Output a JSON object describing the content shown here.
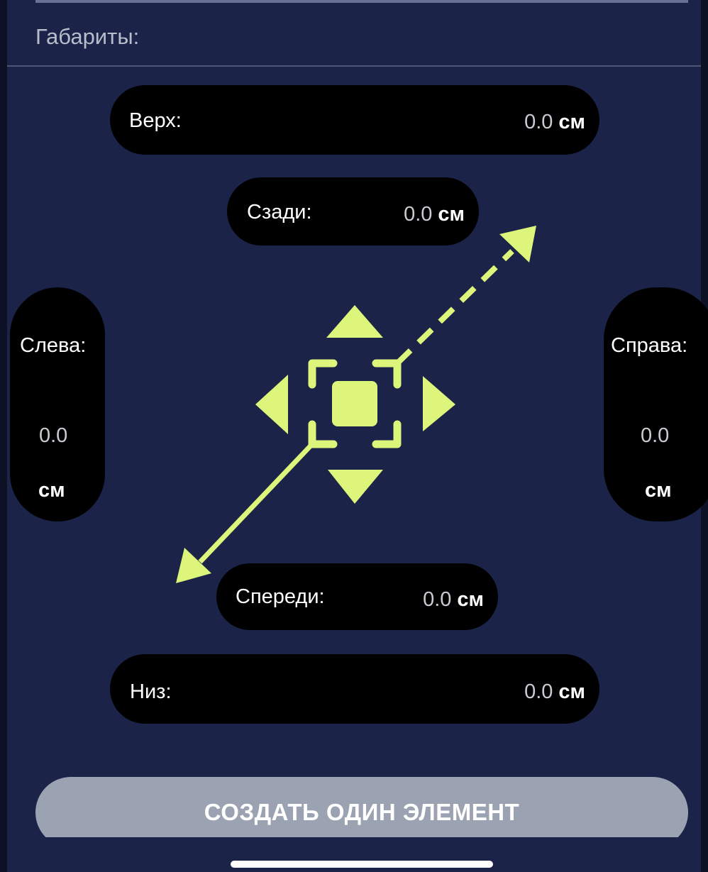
{
  "section": {
    "title": "Габариты:"
  },
  "dimensions": {
    "top": {
      "label": "Верх:",
      "value": "0.0",
      "unit": "см"
    },
    "back": {
      "label": "Сзади:",
      "value": "0.0",
      "unit": "см"
    },
    "left": {
      "label": "Слева:",
      "value": "0.0",
      "unit": "см"
    },
    "right": {
      "label": "Справа:",
      "value": "0.0",
      "unit": "см"
    },
    "front": {
      "label": "Спереди:",
      "value": "0.0",
      "unit": "см"
    },
    "bottom": {
      "label": "Низ:",
      "value": "0.0",
      "unit": "см"
    }
  },
  "icons": {
    "center": "dimensions-cube-icon",
    "accent_color": "#dcf57a"
  },
  "actions": {
    "create_label": "СОЗДАТЬ ОДИН ЭЛЕМЕНТ"
  }
}
